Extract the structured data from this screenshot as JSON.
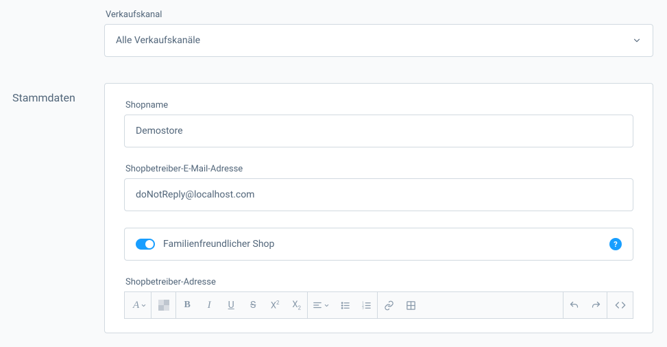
{
  "salesChannel": {
    "label": "Verkaufskanal",
    "value": "Alle Verkaufskanäle"
  },
  "sectionTitle": "Stammdaten",
  "shopName": {
    "label": "Shopname",
    "value": "Demostore"
  },
  "operatorEmail": {
    "label": "Shopbetreiber-E-Mail-Adresse",
    "value": "doNotReply@localhost.com"
  },
  "familyFriendly": {
    "label": "Familienfreundlicher Shop",
    "on": true,
    "helpGlyph": "?"
  },
  "operatorAddress": {
    "label": "Shopbetreiber-Adresse"
  },
  "toolbar": {
    "font": "A",
    "bold": "B",
    "italic": "I",
    "underline": "U",
    "strike": "S",
    "superscript": "X",
    "subscript": "X"
  }
}
